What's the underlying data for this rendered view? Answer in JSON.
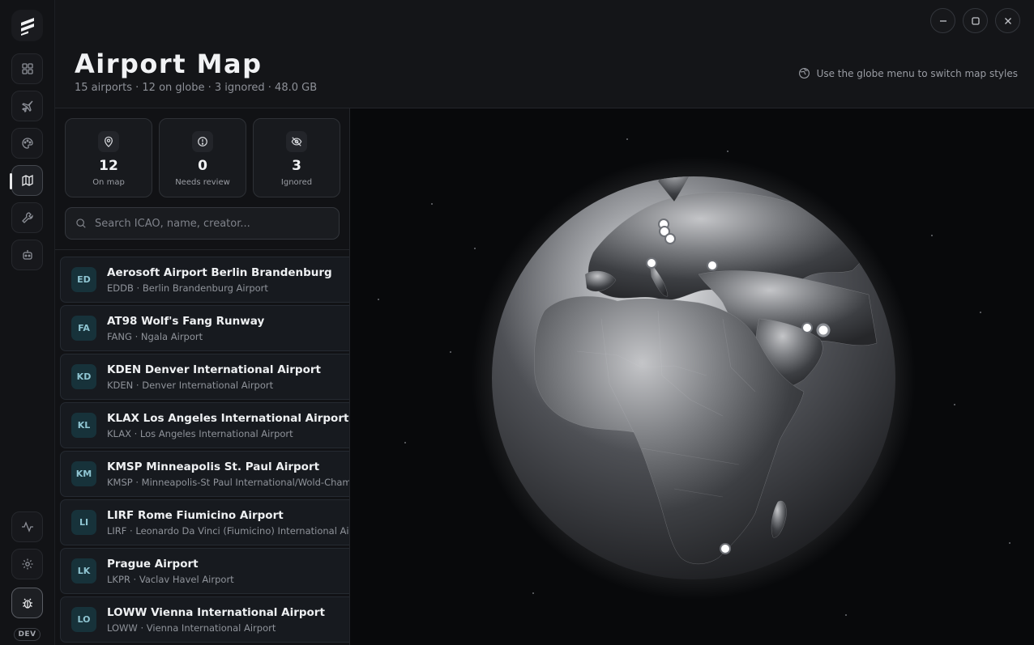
{
  "header": {
    "title": "Airport Map",
    "subtitle": "15 airports · 12 on globe · 3 ignored · 48.0 GB",
    "hint": "Use the globe menu to switch map styles"
  },
  "sidebar": {
    "items": [
      {
        "name": "dashboard",
        "icon": "grid-icon"
      },
      {
        "name": "flights",
        "icon": "plane-icon"
      },
      {
        "name": "themes",
        "icon": "palette-icon"
      },
      {
        "name": "map",
        "icon": "map-icon",
        "active": true
      },
      {
        "name": "tools",
        "icon": "wrench-icon"
      },
      {
        "name": "assistant",
        "icon": "robot-icon"
      }
    ],
    "bottom": [
      {
        "name": "activity",
        "icon": "activity-icon"
      },
      {
        "name": "settings",
        "icon": "gear-icon"
      },
      {
        "name": "debug",
        "icon": "bug-icon"
      }
    ],
    "dev_label": "DEV"
  },
  "stats": [
    {
      "value": "12",
      "label": "On map",
      "icon": "map-pin-icon"
    },
    {
      "value": "0",
      "label": "Needs review",
      "icon": "alert-circle-icon"
    },
    {
      "value": "3",
      "label": "Ignored",
      "icon": "eye-off-icon"
    }
  ],
  "search": {
    "placeholder": "Search ICAO, name, creator..."
  },
  "airports": [
    {
      "badge": "ED",
      "title": "Aerosoft Airport Berlin Brandenburg",
      "subtitle": "EDDB · Berlin Brandenburg Airport"
    },
    {
      "badge": "FA",
      "title": "AT98 Wolf's Fang Runway",
      "subtitle": "FANG · Ngala Airport"
    },
    {
      "badge": "KD",
      "title": "KDEN Denver International Airport",
      "subtitle": "KDEN · Denver International Airport"
    },
    {
      "badge": "KL",
      "title": "KLAX Los Angeles International Airport",
      "subtitle": "KLAX · Los Angeles International Airport"
    },
    {
      "badge": "KM",
      "title": "KMSP Minneapolis St. Paul Airport",
      "subtitle": "KMSP · Minneapolis-St Paul International/Wold-Chamberlain"
    },
    {
      "badge": "LI",
      "title": "LIRF Rome Fiumicino Airport",
      "subtitle": "LIRF · Leonardo Da Vinci (Fiumicino) International Airport"
    },
    {
      "badge": "LK",
      "title": "Prague Airport",
      "subtitle": "LKPR · Vaclav Havel Airport"
    },
    {
      "badge": "LO",
      "title": "LOWW Vienna International Airport",
      "subtitle": "LOWW · Vienna International Airport"
    }
  ],
  "colors": {
    "accent_badge_bg": "#17323a",
    "accent_badge_fg": "#8fc5d2",
    "background": "#0b0c0e"
  }
}
